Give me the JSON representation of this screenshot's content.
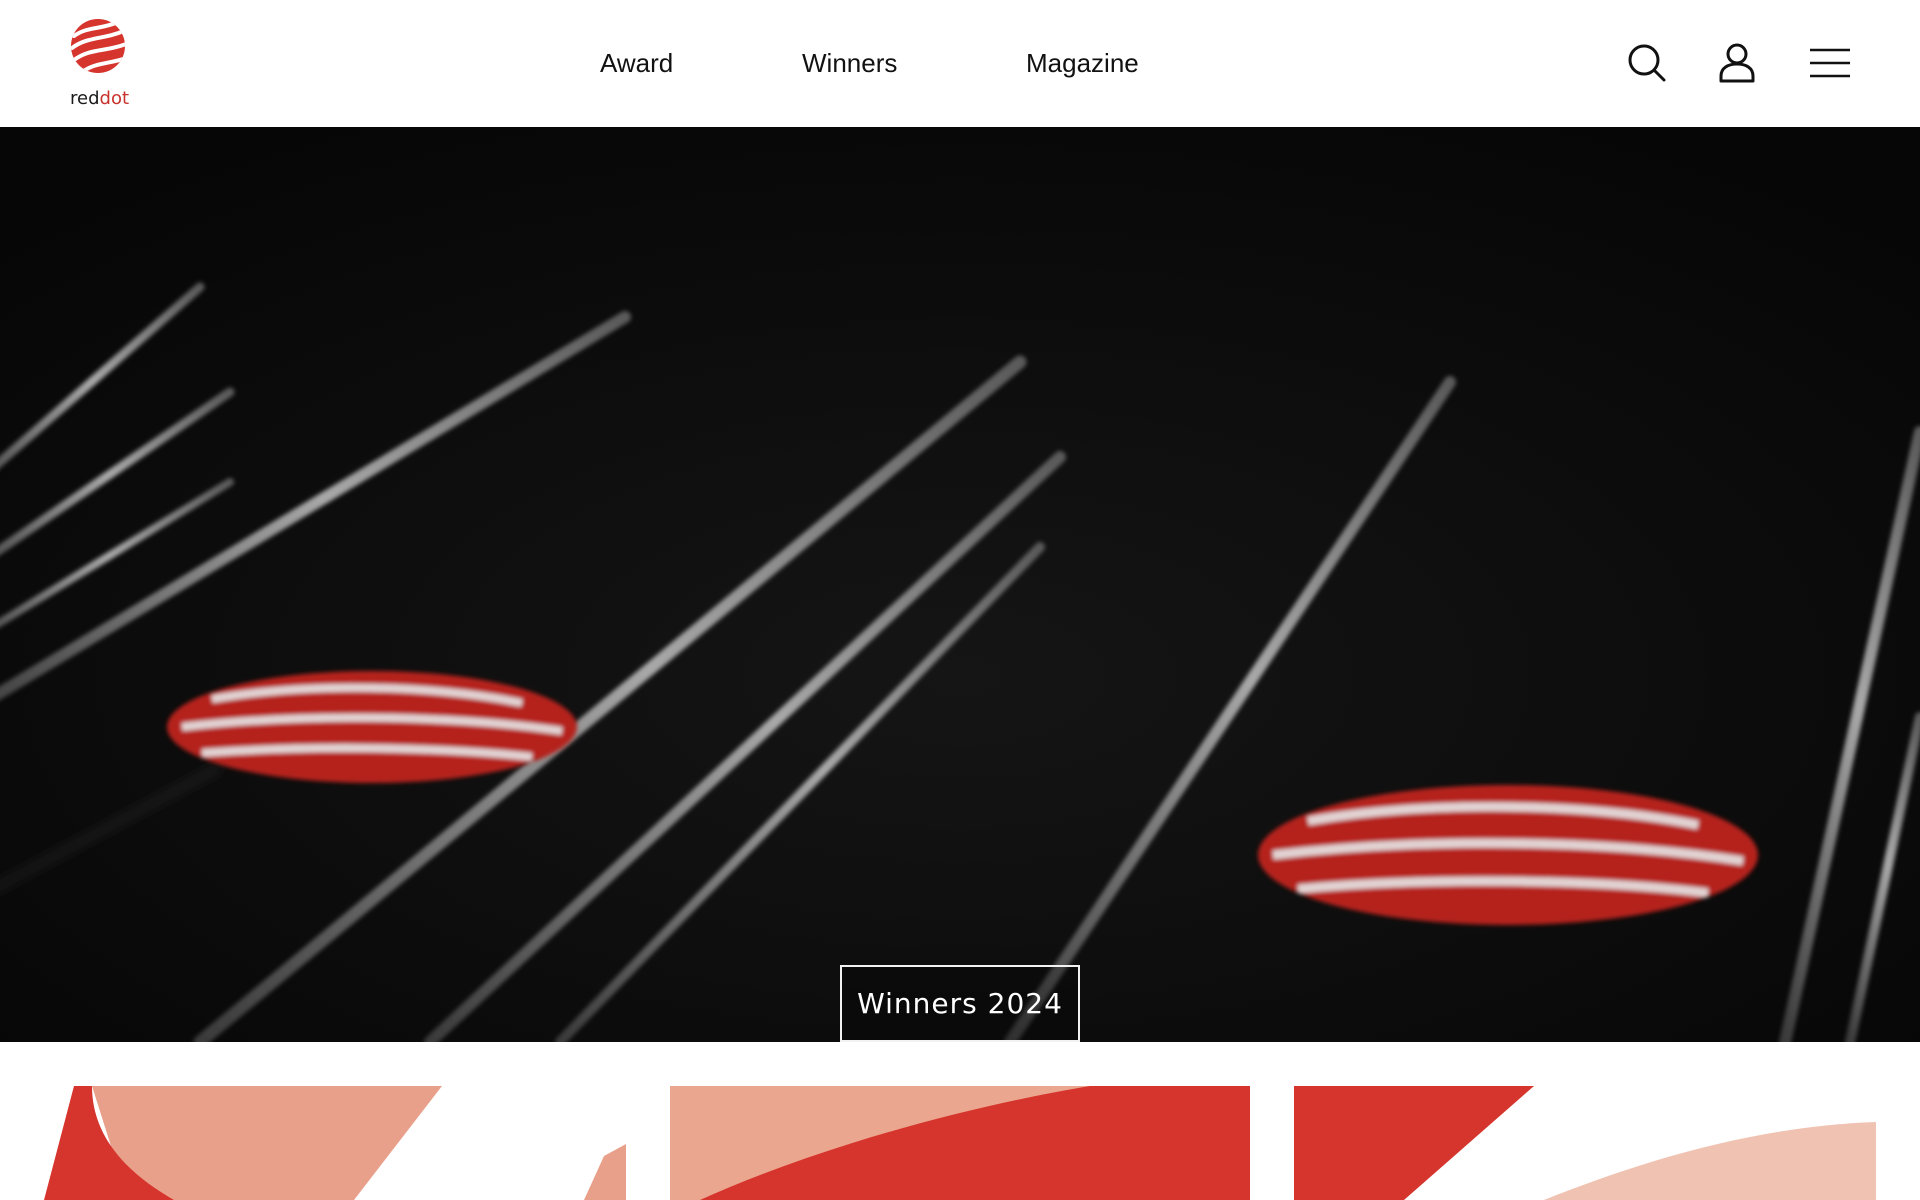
{
  "brand": {
    "name_part1": "red",
    "name_part2": "dot"
  },
  "nav": {
    "items": [
      {
        "label": "Award"
      },
      {
        "label": "Winners"
      },
      {
        "label": "Magazine"
      }
    ]
  },
  "header_actions": {
    "search_icon": "search-icon",
    "account_icon": "user-icon",
    "menu_icon": "menu-icon"
  },
  "hero": {
    "button_label": "Winners 2024"
  },
  "colors": {
    "accent": "#d6352d",
    "accent_light": "#e9a08a",
    "hero_bg": "#0a0a0a"
  }
}
